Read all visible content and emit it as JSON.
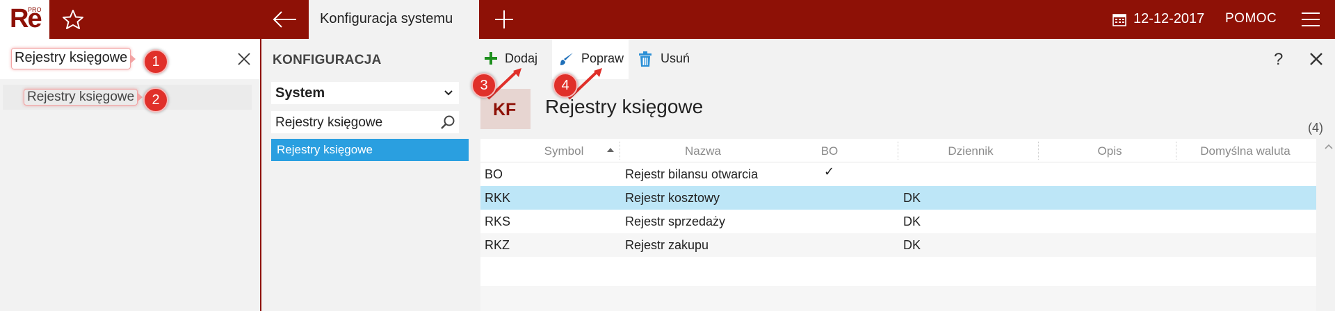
{
  "app": {
    "logo_text": "Re",
    "logo_sup": "PRO",
    "active_tab": "Konfiguracja systemu",
    "date": "12-12-2017",
    "help_label": "POMOC"
  },
  "left_panel": {
    "search_value": "Rejestry księgowe",
    "result_item": "Rejestry księgowe"
  },
  "mid_panel": {
    "title": "KONFIGURACJA",
    "dropdown_value": "System",
    "search_value": "Rejestry księgowe",
    "selected_item": "Rejestry księgowe"
  },
  "toolbar": {
    "add_label": "Dodaj",
    "edit_label": "Popraw",
    "delete_label": "Usuń",
    "help_label": "?"
  },
  "record": {
    "badge": "KF",
    "title": "Rejestry księgowe",
    "count": "(4)"
  },
  "table": {
    "columns": [
      "Symbol",
      "Nazwa",
      "BO",
      "Dziennik",
      "Opis",
      "Domyślna waluta"
    ],
    "rows": [
      {
        "symbol": "BO",
        "nazwa": "Rejestr bilansu otwarcia",
        "bo": "✓",
        "dziennik": "",
        "opis": "",
        "waluta": ""
      },
      {
        "symbol": "RKK",
        "nazwa": "Rejestr kosztowy",
        "bo": "",
        "dziennik": "DK",
        "opis": "",
        "waluta": ""
      },
      {
        "symbol": "RKS",
        "nazwa": "Rejestr sprzedaży",
        "bo": "",
        "dziennik": "DK",
        "opis": "",
        "waluta": ""
      },
      {
        "symbol": "RKZ",
        "nazwa": "Rejestr zakupu",
        "bo": "",
        "dziennik": "DK",
        "opis": "",
        "waluta": ""
      }
    ],
    "selected_row": 1
  },
  "callouts": [
    "1",
    "2",
    "3",
    "4"
  ],
  "colors": {
    "brand": "#8e1106",
    "selection": "#2a9fe0",
    "row_selected": "#bde6f7",
    "callout": "#e0302a",
    "add_icon": "#1e8f1e",
    "edit_icon": "#1f6fb8",
    "delete_icon": "#2a8fd6"
  },
  "icons": [
    "star-icon",
    "back-arrow-icon",
    "plus-icon",
    "calendar-icon",
    "hamburger-icon",
    "close-icon",
    "chevron-down-icon",
    "search-icon",
    "add-icon",
    "brush-icon",
    "trash-icon",
    "sort-up-icon",
    "checkmark-icon"
  ]
}
